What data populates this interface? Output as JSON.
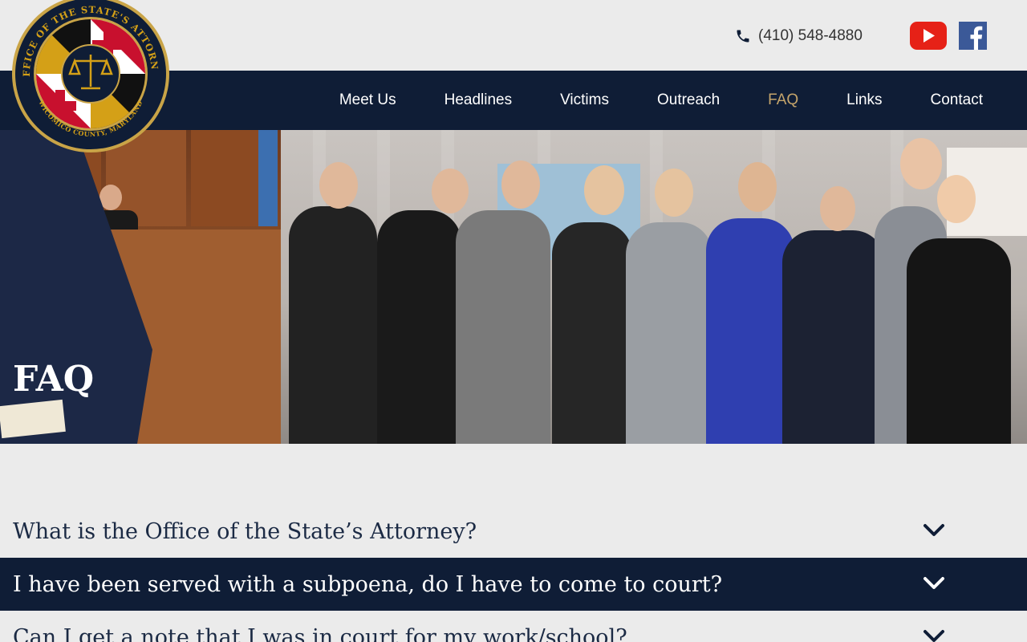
{
  "header": {
    "phone_label": "(410) 548-4880",
    "logo_icon": "office-of-states-attorney-seal",
    "logo_text_top": "OFFICE OF THE STATE'S ATTORNEY",
    "logo_text_bottom": "WICOMICO COUNTY, MARYLAND",
    "social": [
      "youtube-icon",
      "facebook-icon"
    ]
  },
  "nav": {
    "items": [
      {
        "label": "Meet Us",
        "active": false
      },
      {
        "label": "Headlines",
        "active": false
      },
      {
        "label": "Victims",
        "active": false
      },
      {
        "label": "Outreach",
        "active": false
      },
      {
        "label": "FAQ",
        "active": true
      },
      {
        "label": "Links",
        "active": false
      },
      {
        "label": "Contact",
        "active": false
      }
    ]
  },
  "hero": {
    "title": "FAQ"
  },
  "faq": {
    "items": [
      {
        "question": "What is the Office of the State’s Attorney?",
        "expanded": false
      },
      {
        "question": "I have been served with a subpoena, do I have to come to court?",
        "expanded": true
      },
      {
        "question": "Can I get a note that I was in court for my work/school?",
        "expanded": false
      }
    ]
  },
  "colors": {
    "navy": "#0f1d36",
    "gold_active": "#c4a46b",
    "page_bg": "#ebebeb",
    "youtube_red": "#e62117",
    "facebook_blue": "#3b5998"
  }
}
